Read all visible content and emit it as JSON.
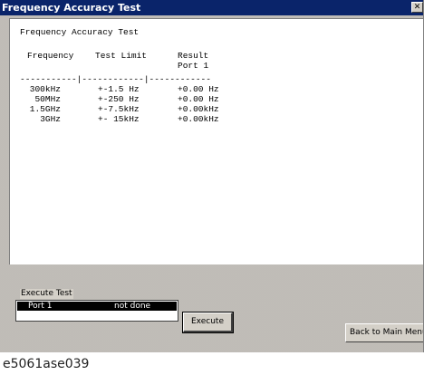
{
  "window": {
    "title": "Frequency Accuracy Test",
    "close_glyph": "✕"
  },
  "report": {
    "heading": "Frequency Accuracy Test",
    "columns": {
      "frequency": "Frequency",
      "test_limit": "Test Limit",
      "result": "Result",
      "result_sub": "Port 1"
    },
    "separator": "-----------|------------|------------",
    "rows": [
      {
        "frequency": "300kHz",
        "limit": "+-1.5 Hz",
        "result": "+0.00 Hz"
      },
      {
        "frequency": "50MHz",
        "limit": "+-250 Hz",
        "result": "+0.00 Hz"
      },
      {
        "frequency": "1.5GHz",
        "limit": "+-7.5kHz",
        "result": "+0.00kHz"
      },
      {
        "frequency": "3GHz",
        "limit": "+- 15kHz",
        "result": "+0.00kHz"
      }
    ]
  },
  "execute_test": {
    "group_label": "Execute Test",
    "list_items": [
      {
        "port": "Port 1",
        "status": "not done"
      }
    ],
    "execute_label": "Execute"
  },
  "footer": {
    "back_label": "Back to Main Menu"
  },
  "caption": "e5061ase039"
}
